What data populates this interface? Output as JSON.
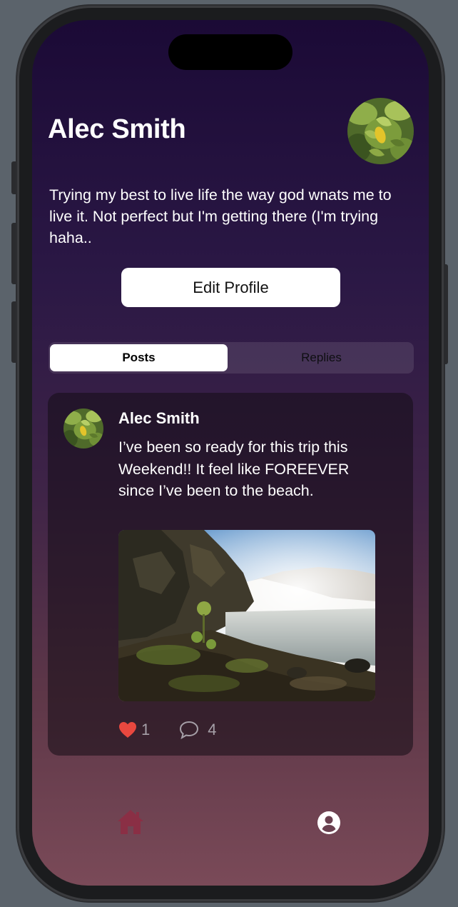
{
  "profile": {
    "name": "Alec Smith",
    "bio": "Trying my best to live life the way god wnats me to live it. Not perfect but I'm getting there (I'm trying haha..",
    "edit_button_label": "Edit Profile"
  },
  "tabs": [
    {
      "label": "Posts",
      "selected": true
    },
    {
      "label": "Replies",
      "selected": false
    }
  ],
  "post": {
    "author": "Alec Smith",
    "text": "I’ve been so ready for this trip this Weekend!! It feel like FOREEVER since I’ve been to the beach.",
    "likes": "1",
    "comments": "4",
    "liked": true
  },
  "tabbar": {
    "items": [
      {
        "icon": "house-icon",
        "selected": false
      },
      {
        "icon": "person-circle-icon",
        "selected": true
      }
    ]
  },
  "colors": {
    "heart": "#e8483f",
    "home_icon": "#8a2f45",
    "bg_top": "#1b0a36",
    "bg_bottom": "#7a4a58"
  }
}
